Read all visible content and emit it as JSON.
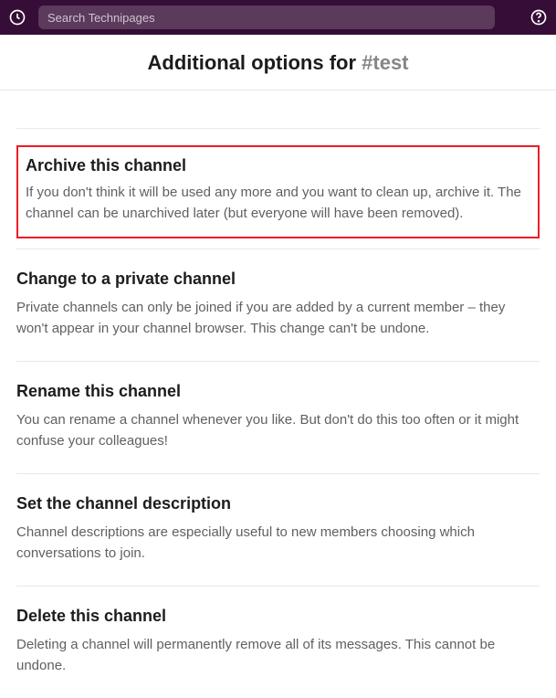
{
  "topbar": {
    "search_placeholder": "Search Technipages"
  },
  "header": {
    "title_prefix": "Additional options for ",
    "channel": "#test"
  },
  "options": {
    "archive": {
      "title": "Archive this channel",
      "desc": "If you don't think it will be used any more and you want to clean up, archive it. The channel can be unarchived later (but everyone will have been removed)."
    },
    "private": {
      "title": "Change to a private channel",
      "desc": "Private channels can only be joined if you are added by a current member – they won't appear in your channel browser. This change can't be undone."
    },
    "rename": {
      "title": "Rename this channel",
      "desc": "You can rename a channel whenever you like. But don't do this too often or it might confuse your colleagues!"
    },
    "description": {
      "title": "Set the channel description",
      "desc": "Channel descriptions are especially useful to new members choosing which conversations to join."
    },
    "delete": {
      "title": "Delete this channel",
      "desc": "Deleting a channel will permanently remove all of its messages. This cannot be undone."
    }
  }
}
